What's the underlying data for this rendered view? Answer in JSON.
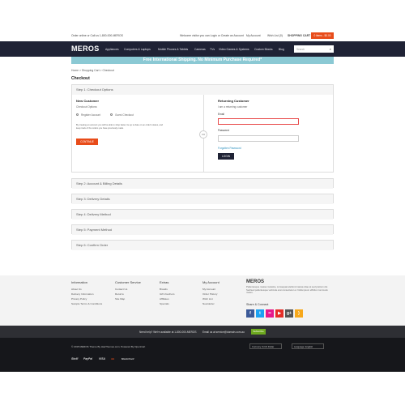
{
  "topbar": {
    "left_text": "Order online or Call us 1-800-000-MEROS",
    "welcome": "Welcome visitor you can Login or Create an Account",
    "my_account": "My Account",
    "wishlist": "Wish List (0)",
    "shopping_cart": "SHOPPING CART",
    "cart_btn": "0 items - $0.00"
  },
  "nav": {
    "logo": "MEROS",
    "items": [
      "Appliances",
      "Computers & Laptops",
      "Mobile Phones & Tablets",
      "Cameras",
      "TVs",
      "Video Games & Systems",
      "Custom Blocks",
      "Blog"
    ],
    "search_placeholder": "Search"
  },
  "promo": "Free International Shipping. No Minimum Purchase Required*",
  "breadcrumb": "Home   >   Shopping Cart   >   Checkout",
  "page_title": "Checkout",
  "step1": {
    "title": "Step 1: Checkout Options",
    "new_customer": {
      "title": "New Customer",
      "checkout_options": "Checkout Options:",
      "register": "Register Account",
      "guest": "Guest Checkout",
      "desc1": "By creating an account you will be able to shop faster, be up to date on an order's status, and",
      "desc2": "keep track of the orders you have previously made.",
      "continue": "CONTINUE"
    },
    "or": "OR",
    "returning": {
      "title": "Returning Customer",
      "subtitle": "I am a returning customer",
      "email_label": "Email",
      "password_label": "Password",
      "forgot": "Forgotten Password",
      "login": "LOGIN"
    }
  },
  "steps": [
    "Step 2: Account & Billing Details",
    "Step 3: Delivery Details",
    "Step 4: Delivery Method",
    "Step 5: Payment Method",
    "Step 6: Confirm Order"
  ],
  "footer": {
    "columns": [
      {
        "title": "Information",
        "links": [
          "About Us",
          "Delivery Information",
          "Privacy Policy",
          "Sample Terms & Conditions"
        ]
      },
      {
        "title": "Customer Service",
        "links": [
          "Contact Us",
          "Returns",
          "Site Map"
        ]
      },
      {
        "title": "Extras",
        "links": [
          "Brands",
          "Gift Vouchers",
          "Affiliates",
          "Specials"
        ]
      },
      {
        "title": "My Account",
        "links": [
          "My Account",
          "Order History",
          "Wish List",
          "Newsletter"
        ]
      }
    ],
    "logo": "MEROS",
    "desc": "Pellentesque massa molestie, consequat eleifend massa vitae at sed pretium dui. Sed/sed pellentesque vehicula erat consectetur et. Nulla ipsum efficitur commodo metus.",
    "share": "Share & Connect",
    "social": [
      {
        "icon": "facebook-icon",
        "glyph": "f",
        "color": "#3b5998"
      },
      {
        "icon": "twitter-icon",
        "glyph": "t",
        "color": "#1da1f2"
      },
      {
        "icon": "flickr-icon",
        "glyph": "••",
        "color": "#e6188c"
      },
      {
        "icon": "youtube-icon",
        "glyph": "▶",
        "color": "#e52d27"
      },
      {
        "icon": "google-plus-icon",
        "glyph": "g+",
        "color": "#555555"
      },
      {
        "icon": "rss-icon",
        "glyph": ")",
        "color": "#f7a81b"
      }
    ]
  },
  "helpbar": {
    "help": "Need help? We're available at 1-800-000-MEROS",
    "email": "Email us at service@domain.com.au",
    "subscribe": "Subscribe"
  },
  "bottom": {
    "copyright": "© 2015 MEROS Theme By HasThemes.com. Powered By OpenCart",
    "currency": "Currency: $ US Dollar",
    "language": "Language: English",
    "payments": [
      "Skrill",
      "PayPal",
      "VISA",
      "●●",
      "MasterCard"
    ]
  },
  "colors": {
    "nav_bg": "#1f2235",
    "accent": "#e84c1a",
    "promo": "#8bc9d4"
  }
}
